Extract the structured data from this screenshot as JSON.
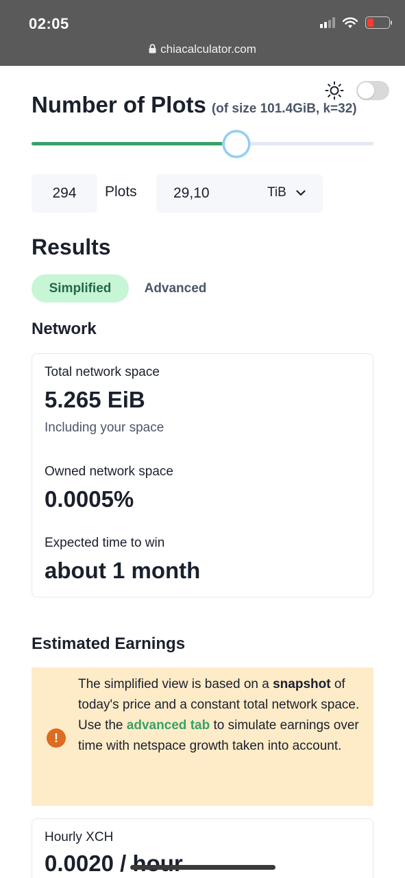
{
  "status_bar": {
    "time": "02:05",
    "url": "chiacalculator.com"
  },
  "plots": {
    "title": "Number of Plots",
    "subtitle": "(of size 101.4GiB, k=32)",
    "slider_fraction": 0.6,
    "count": "294",
    "count_label": "Plots",
    "size_value": "29,10",
    "size_unit": "TiB"
  },
  "results": {
    "title": "Results",
    "tabs": [
      {
        "label": "Simplified",
        "active": true
      },
      {
        "label": "Advanced",
        "active": false
      }
    ]
  },
  "network": {
    "title": "Network",
    "total_label": "Total network space",
    "total_value": "5.265 EiB",
    "total_help": "Including your space",
    "owned_label": "Owned network space",
    "owned_value": "0.0005%",
    "time_label": "Expected time to win",
    "time_value": "about 1 month"
  },
  "earnings": {
    "title": "Estimated Earnings",
    "alert": {
      "text_1": "The simplified view is based on a",
      "bold_1": "snapshot",
      "text_2": "of today's price and a constant total network space.",
      "text_3": "Use the",
      "link": "advanced tab",
      "text_4": "to simulate earnings over time with netspace growth taken into account."
    },
    "hourly_label": "Hourly XCH",
    "hourly_value": "0.0020 / hour"
  },
  "colors": {
    "accent": "#38a169",
    "alert_bg": "#feebc8",
    "alert_icon": "#dd6b20",
    "tab_active_bg": "#c6f6d5"
  }
}
